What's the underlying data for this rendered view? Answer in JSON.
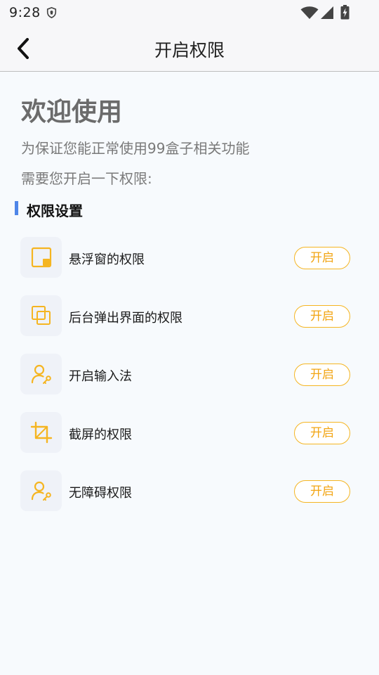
{
  "status_bar": {
    "time": "9:28",
    "icons": [
      "shield-icon",
      "wifi-icon",
      "signal-icon",
      "battery-charging-icon"
    ]
  },
  "header": {
    "title": "开启权限",
    "back_icon": "back-chevron-icon"
  },
  "welcome": {
    "title": "欢迎使用",
    "line1": "为保证您能正常使用99盒子相关功能",
    "line2": "需要您开启一下权限:"
  },
  "section": {
    "title": "权限设置",
    "accent_color": "#4f86e8"
  },
  "permissions": [
    {
      "label": "悬浮窗的权限",
      "icon": "floating-window-icon",
      "button": "开启"
    },
    {
      "label": "后台弹出界面的权限",
      "icon": "overlapping-windows-icon",
      "button": "开启"
    },
    {
      "label": "开启输入法",
      "icon": "user-key-icon",
      "button": "开启"
    },
    {
      "label": "截屏的权限",
      "icon": "crop-icon",
      "button": "开启"
    },
    {
      "label": "无障碍权限",
      "icon": "user-key-icon",
      "button": "开启"
    }
  ],
  "colors": {
    "accent_orange": "#f5b521",
    "background": "#f7fafd"
  }
}
